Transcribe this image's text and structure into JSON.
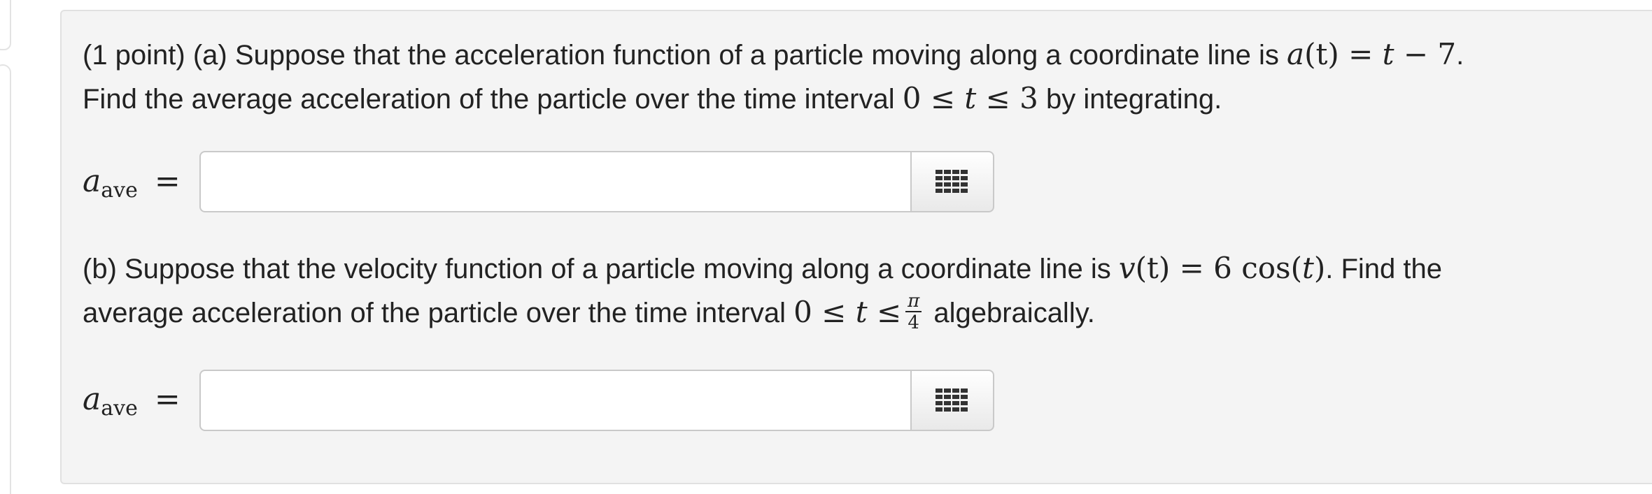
{
  "question": {
    "part_a": {
      "lead": "(1 point) (a) Suppose that the acceleration function of a particle moving along a coordinate line is ",
      "func_lhs": "a",
      "func_arg": "(t)",
      "func_eq": " = ",
      "func_rhs_var": "t",
      "func_rhs_rest": " − 7",
      "line1_end": ".",
      "line2_start": "Find the average acceleration of the particle over the time interval ",
      "interval_low": "0 ≤ ",
      "interval_var": "t",
      "interval_high": " ≤ 3",
      "line2_end": " by integrating."
    },
    "part_b": {
      "lead": "(b) Suppose that the velocity function of a particle moving along a coordinate line is ",
      "func_lhs": "v",
      "func_arg": "(t)",
      "func_eq": " = 6 cos",
      "func_arg2_open": "(",
      "func_arg2_var": "t",
      "func_arg2_close": ")",
      "line1_end": ". Find the",
      "line2_start": "average acceleration of the particle over the time interval ",
      "interval_low": "0 ≤ ",
      "interval_var": "t",
      "interval_mid": " ≤",
      "frac_num": "π",
      "frac_den": "4",
      "line2_end": " algebraically."
    }
  },
  "answers": {
    "label_var": "a",
    "label_sub": "ave",
    "label_eq": "=",
    "input_a_value": "",
    "input_b_value": ""
  },
  "icons": {
    "palette_button": "equation-palette-grid-icon"
  },
  "colors": {
    "panel_background": "#f4f4f4",
    "panel_border": "#e1e1e1",
    "icon_color": "#333333"
  }
}
